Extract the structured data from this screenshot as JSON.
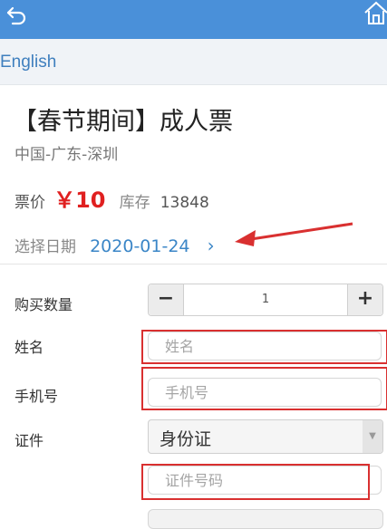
{
  "nav": {
    "back_icon": "back-arrow-icon",
    "home_icon": "home-icon"
  },
  "lang": {
    "label": "English"
  },
  "ticket": {
    "title": "【春节期间】成人票",
    "location": "中国-广东-深圳",
    "price_label": "票价",
    "price": "￥10",
    "stock_label": "库存",
    "stock": "13848",
    "date_label": "选择日期",
    "date": "2020-01-24",
    "date_chevron": "›"
  },
  "form": {
    "quantity_label": "购买数量",
    "quantity_value": "1",
    "minus": "−",
    "plus": "+",
    "name_label": "姓名",
    "name_placeholder": "姓名",
    "phone_label": "手机号",
    "phone_placeholder": "手机号",
    "id_label": "证件",
    "id_type": "身份证",
    "id_number_placeholder": "证件号码"
  },
  "colors": {
    "topbar": "#4a90d9",
    "price": "#e02020",
    "link": "#3b86c7",
    "highlight": "#d93030"
  }
}
